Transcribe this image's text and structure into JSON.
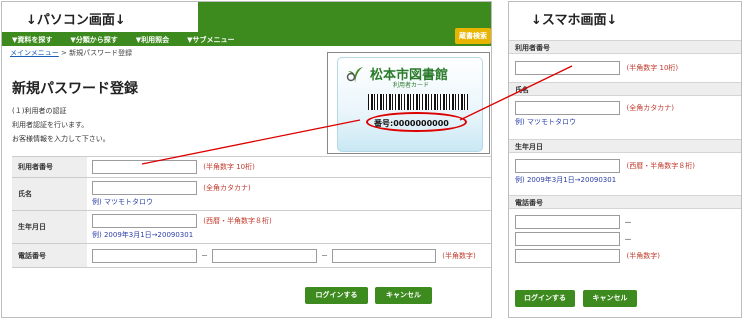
{
  "pc": {
    "header_title": "↓パソコン画面↓",
    "menu": [
      "▼資料を探す",
      "▼分類から探す",
      "▼利用照会",
      "▼サブメニュー"
    ],
    "corner_button": "蔵書検索",
    "breadcrumb_home": "メインメニュー",
    "breadcrumb_sep": ">",
    "breadcrumb_current": "新規パスワード登録",
    "page_title": "新規パスワード登録",
    "section1": "(１)利用者の認証",
    "section2": "利用者認証を行います。",
    "section3": "お客様情報を入力して下さい。",
    "fields": {
      "card_number": {
        "label": "利用者番号",
        "note": "(半角数字 10桁)"
      },
      "name": {
        "label": "氏名",
        "note": "(全角カタカナ)",
        "example": "例) マツモトタロウ"
      },
      "birthdate": {
        "label": "生年月日",
        "note": "(西暦・半角数字８桁)",
        "example": "例) 2009年3月1日→20090301"
      },
      "phone": {
        "label": "電話番号",
        "dash": "－",
        "note": "(半角数字)"
      }
    },
    "login_button": "ログインする",
    "cancel_button": "キャンセル"
  },
  "card": {
    "library_name": "松本市図書館",
    "card_type": "利用者カード",
    "number": "番号:0000000000"
  },
  "sp": {
    "header_title": "↓スマホ画面↓",
    "fields": {
      "card_number": {
        "label": "利用者番号",
        "note": "(半角数字 10桁)"
      },
      "name": {
        "label": "氏名",
        "note": "(全角カタカナ)",
        "example": "例) マツモトタロウ"
      },
      "birthdate": {
        "label": "生年月日",
        "note": "(西暦・半角数字８桁)",
        "example": "例) 2009年3月1日→20090301"
      },
      "phone": {
        "label": "電話番号",
        "dash": "－",
        "note": "(半角数字)"
      }
    },
    "login_button": "ログインする",
    "cancel_button": "キャンセル"
  },
  "colors": {
    "accent": "#3d8a1e",
    "note": "#c0392b",
    "example": "#2b3fa8",
    "highlight": "#dd0000"
  }
}
